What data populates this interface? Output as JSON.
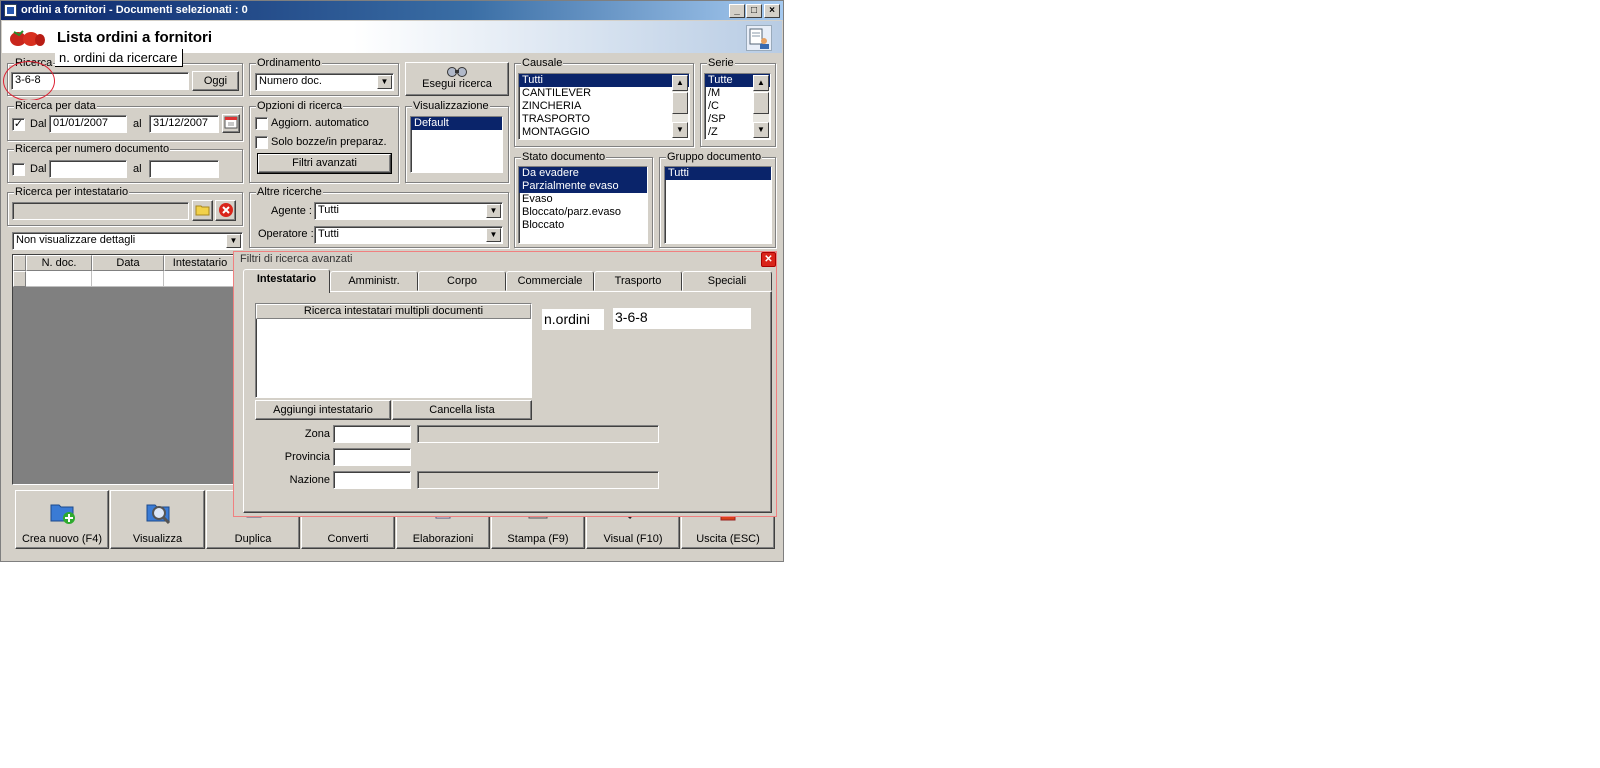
{
  "window": {
    "title": "ordini a fornitori - Documenti selezionati : 0",
    "min": "_",
    "max": "□",
    "close": "×"
  },
  "header": {
    "title": "Lista ordini a fornitori"
  },
  "ricerca": {
    "legend": "Ricerca",
    "value": "3-6-8",
    "oggi": "Oggi"
  },
  "annotation": {
    "text": "n. ordini da ricercare"
  },
  "ricerca_data": {
    "legend": "Ricerca per data",
    "dal_label": "Dal",
    "dal_checked": "✓",
    "dal": "01/01/2007",
    "al_label": "al",
    "al": "31/12/2007"
  },
  "ricerca_numero": {
    "legend": "Ricerca per numero documento",
    "dal_label": "Dal",
    "al_label": "al"
  },
  "ricerca_intestatario": {
    "legend": "Ricerca per intestatario"
  },
  "dettagli": {
    "value": "Non visualizzare dettagli"
  },
  "grid": {
    "columns": [
      "N. doc.",
      "Data",
      "Intestatario"
    ]
  },
  "ordinamento": {
    "legend": "Ordinamento",
    "value": "Numero doc."
  },
  "esegui": {
    "label": "Esegui ricerca"
  },
  "opzioni": {
    "legend": "Opzioni di ricerca",
    "aggiorn": "Aggiorn. automatico",
    "bozze": "Solo bozze/in preparaz.",
    "filtri": "Filtri avanzati"
  },
  "visualizzazione": {
    "legend": "Visualizzazione",
    "items": [
      "Default"
    ]
  },
  "altre": {
    "legend": "Altre ricerche",
    "agente_label": "Agente :",
    "agente": "Tutti",
    "operatore_label": "Operatore :",
    "operatore": "Tutti"
  },
  "causale": {
    "legend": "Causale",
    "items": [
      "Tutti",
      "CANTILEVER",
      "ZINCHERIA",
      "TRASPORTO",
      "MONTAGGIO"
    ]
  },
  "serie": {
    "legend": "Serie",
    "items": [
      "Tutte",
      "/M",
      "/C",
      "/SP",
      "/Z"
    ]
  },
  "stato": {
    "legend": "Stato documento",
    "items": [
      "Da evadere",
      "Parzialmente evaso",
      "Evaso",
      "Bloccato/parz.evaso",
      "Bloccato"
    ]
  },
  "gruppo": {
    "legend": "Gruppo documento",
    "items": [
      "Tutti"
    ]
  },
  "buttons": [
    "Crea nuovo (F4)",
    "Visualizza",
    "Duplica",
    "Converti",
    "Elaborazioni",
    "Stampa (F9)",
    "Visual (F10)",
    "Uscita (ESC)"
  ],
  "filtri_panel": {
    "title": "Filtri di ricerca avanzati",
    "tabs": [
      "Intestatario",
      "Amministr.",
      "Corpo",
      "Commerciale",
      "Trasporto",
      "Speciali"
    ],
    "multi_header": "Ricerca intestatari multipli documenti",
    "aggiungi": "Aggiungi intestatario",
    "cancella": "Cancella lista",
    "norders_label": "n.ordini",
    "norders_value": "3-6-8",
    "zona": "Zona",
    "provincia": "Provincia",
    "nazione": "Nazione"
  }
}
